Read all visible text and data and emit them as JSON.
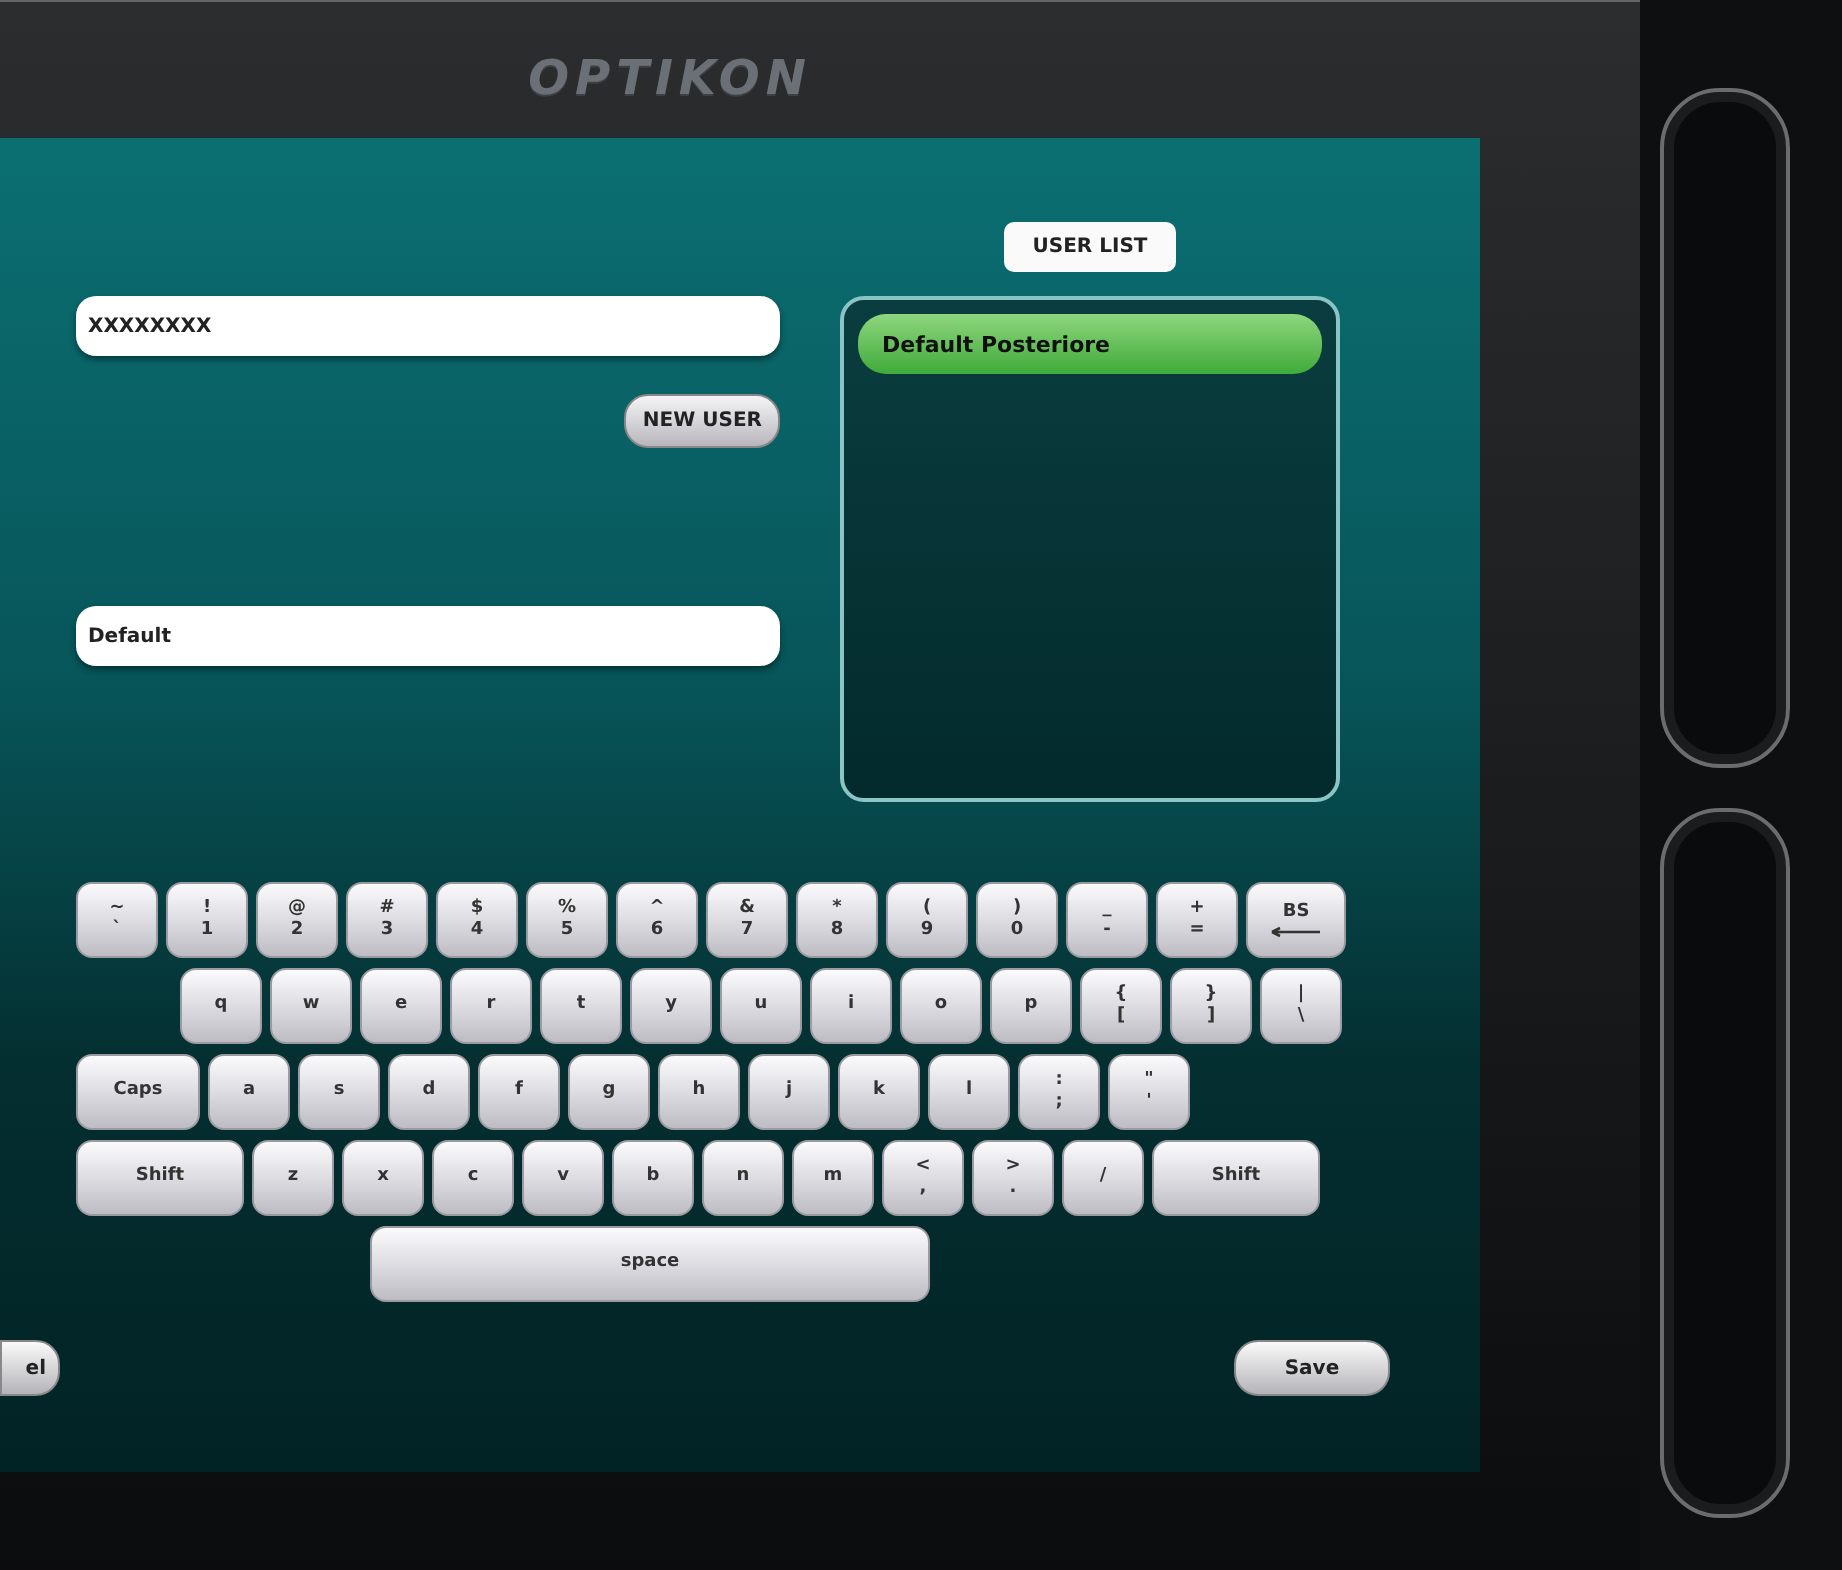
{
  "device": {
    "logo": "OPTIKON"
  },
  "form": {
    "user_field": {
      "value": "XXXXXXXX"
    },
    "new_user_button": "NEW USER",
    "profile_field": {
      "value": "Default"
    }
  },
  "user_list": {
    "title": "USER LIST",
    "items": [
      {
        "label": "Default Posteriore",
        "selected": true
      }
    ]
  },
  "keyboard": {
    "rows": [
      {
        "keys": [
          {
            "kind": "dual",
            "upper": "~",
            "lower": "`"
          },
          {
            "kind": "dual",
            "upper": "!",
            "lower": "1"
          },
          {
            "kind": "dual",
            "upper": "@",
            "lower": "2"
          },
          {
            "kind": "dual",
            "upper": "#",
            "lower": "3"
          },
          {
            "kind": "dual",
            "upper": "$",
            "lower": "4"
          },
          {
            "kind": "dual",
            "upper": "%",
            "lower": "5"
          },
          {
            "kind": "dual",
            "upper": "^",
            "lower": "6"
          },
          {
            "kind": "dual",
            "upper": "&",
            "lower": "7"
          },
          {
            "kind": "dual",
            "upper": "*",
            "lower": "8"
          },
          {
            "kind": "dual",
            "upper": "(",
            "lower": "9"
          },
          {
            "kind": "dual",
            "upper": ")",
            "lower": "0"
          },
          {
            "kind": "dual",
            "upper": "_",
            "lower": "-"
          },
          {
            "kind": "dual",
            "upper": "+",
            "lower": "="
          },
          {
            "kind": "backspace",
            "label": "BS"
          }
        ]
      },
      {
        "keys": [
          {
            "kind": "single",
            "label": "q"
          },
          {
            "kind": "single",
            "label": "w"
          },
          {
            "kind": "single",
            "label": "e"
          },
          {
            "kind": "single",
            "label": "r"
          },
          {
            "kind": "single",
            "label": "t"
          },
          {
            "kind": "single",
            "label": "y"
          },
          {
            "kind": "single",
            "label": "u"
          },
          {
            "kind": "single",
            "label": "i"
          },
          {
            "kind": "single",
            "label": "o"
          },
          {
            "kind": "single",
            "label": "p"
          },
          {
            "kind": "dual",
            "upper": "{",
            "lower": "["
          },
          {
            "kind": "dual",
            "upper": "}",
            "lower": "]"
          },
          {
            "kind": "dual",
            "upper": "|",
            "lower": "\\"
          }
        ]
      },
      {
        "keys": [
          {
            "kind": "wide",
            "label": "Caps"
          },
          {
            "kind": "single",
            "label": "a"
          },
          {
            "kind": "single",
            "label": "s"
          },
          {
            "kind": "single",
            "label": "d"
          },
          {
            "kind": "single",
            "label": "f"
          },
          {
            "kind": "single",
            "label": "g"
          },
          {
            "kind": "single",
            "label": "h"
          },
          {
            "kind": "single",
            "label": "j"
          },
          {
            "kind": "single",
            "label": "k"
          },
          {
            "kind": "single",
            "label": "l"
          },
          {
            "kind": "dual",
            "upper": ":",
            "lower": ";"
          },
          {
            "kind": "dual",
            "upper": "\"",
            "lower": "'"
          }
        ]
      },
      {
        "keys": [
          {
            "kind": "shift",
            "label": "Shift"
          },
          {
            "kind": "single",
            "label": "z"
          },
          {
            "kind": "single",
            "label": "x"
          },
          {
            "kind": "single",
            "label": "c"
          },
          {
            "kind": "single",
            "label": "v"
          },
          {
            "kind": "single",
            "label": "b"
          },
          {
            "kind": "single",
            "label": "n"
          },
          {
            "kind": "single",
            "label": "m"
          },
          {
            "kind": "dual",
            "upper": "<",
            "lower": ","
          },
          {
            "kind": "dual",
            "upper": ">",
            "lower": "."
          },
          {
            "kind": "single",
            "label": "/"
          },
          {
            "kind": "shift",
            "label": "Shift"
          }
        ]
      },
      {
        "keys": [
          {
            "kind": "space",
            "label": "space"
          }
        ]
      }
    ]
  },
  "footer": {
    "cancel_button": "el",
    "save_button": "Save"
  }
}
